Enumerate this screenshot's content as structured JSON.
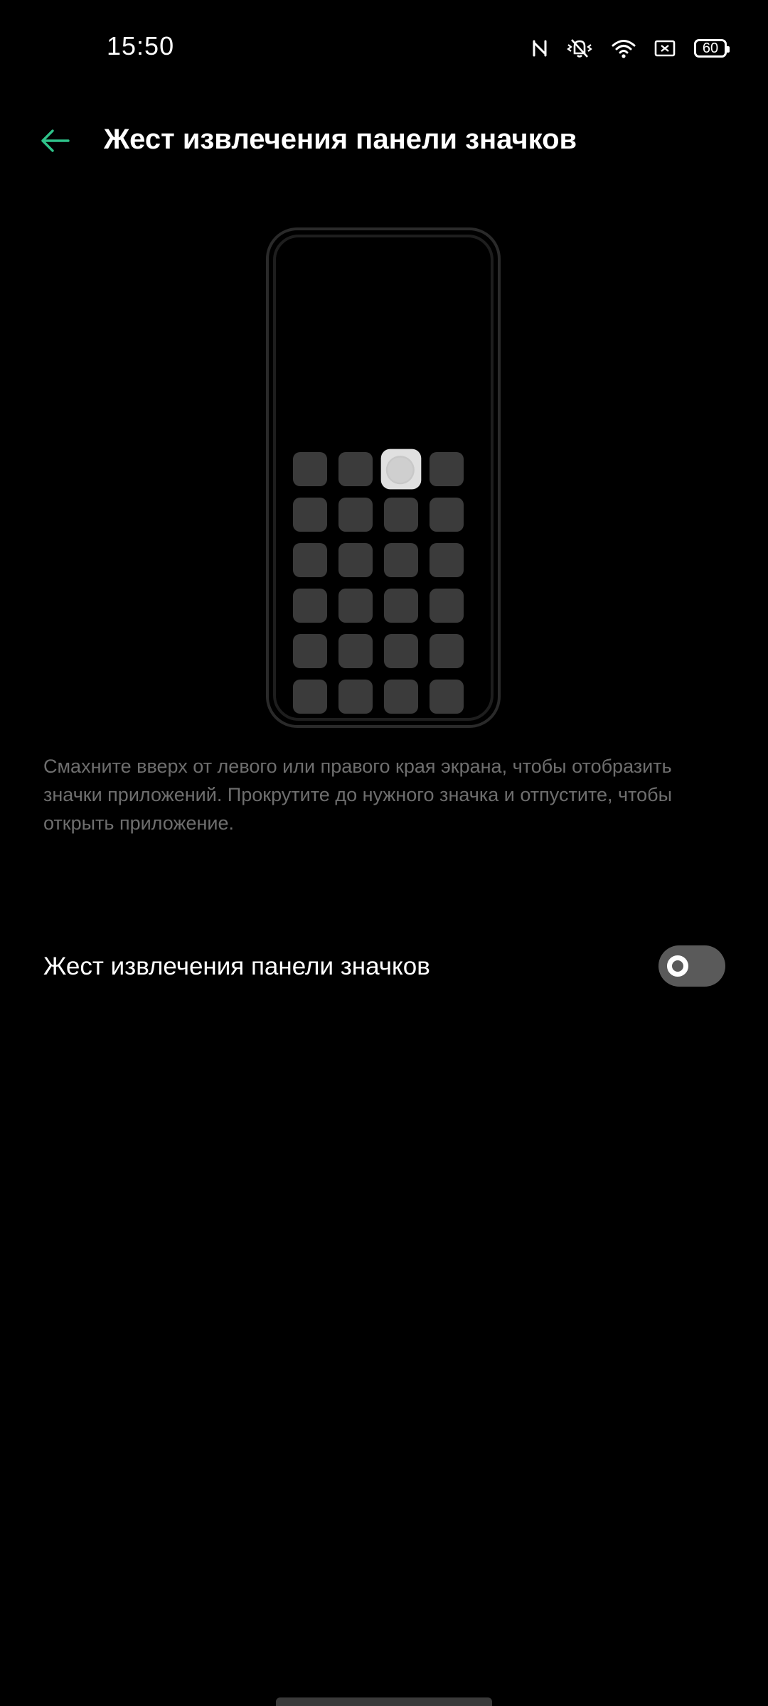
{
  "status_bar": {
    "time": "15:50",
    "icons": [
      "nfc-icon",
      "vibrate-off-icon",
      "wifi-icon",
      "screen-cast-icon",
      "battery-icon"
    ],
    "battery_level": "60"
  },
  "header": {
    "back_icon": "arrow-left-icon",
    "title": "Жест извлечения панели значков"
  },
  "illustration": {
    "rows": 6,
    "columns": 4,
    "highlighted_tile": "row 1, column 3"
  },
  "description": "Смахните вверх от левого или правого края экрана, чтобы отобразить значки приложений. Прокрутите до нужного значка и отпустите, чтобы открыть приложение.",
  "setting": {
    "label": "Жест извлечения панели значков",
    "enabled": false
  },
  "colors": {
    "background": "#000000",
    "accent": "#2fc38a",
    "description_text": "#6e6e6e",
    "toggle_off": "#5a5a5a"
  }
}
